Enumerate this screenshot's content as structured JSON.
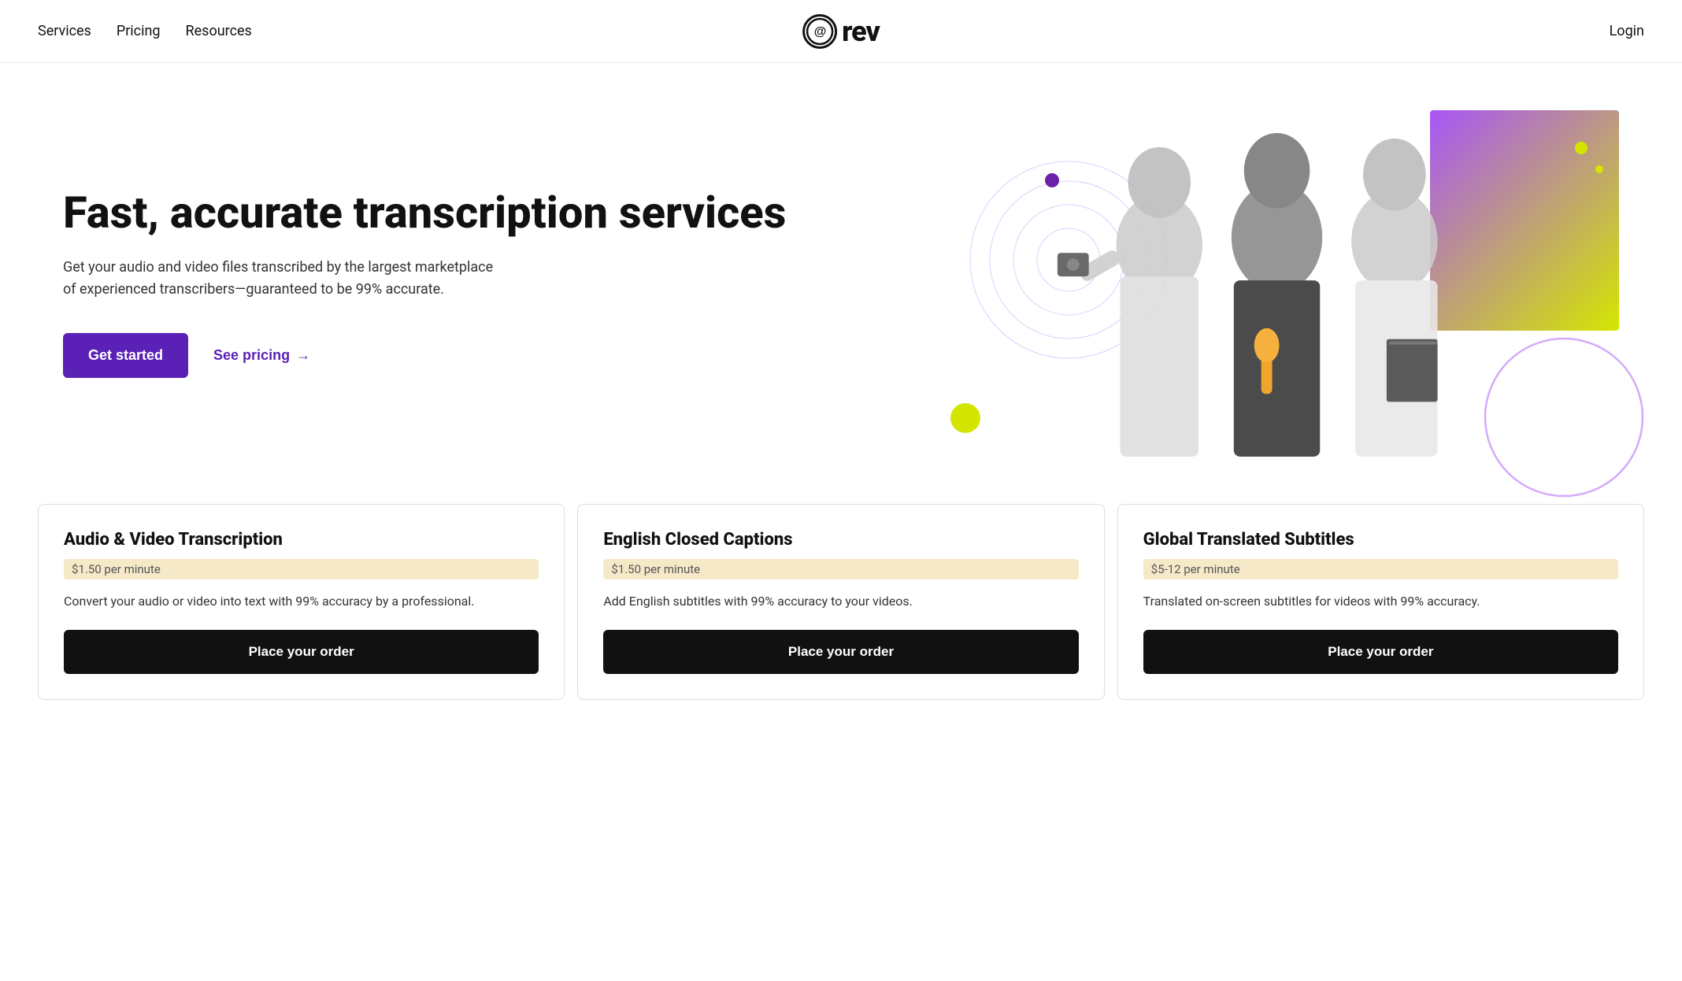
{
  "header": {
    "nav_left": [
      {
        "label": "Services",
        "id": "services"
      },
      {
        "label": "Pricing",
        "id": "pricing"
      },
      {
        "label": "Resources",
        "id": "resources"
      }
    ],
    "logo_text": "rev",
    "logo_at": "@",
    "login_label": "Login"
  },
  "hero": {
    "title": "Fast, accurate transcription services",
    "subtitle": "Get your audio and video files transcribed by the largest marketplace of experienced transcribers—guaranteed to be 99% accurate.",
    "cta_primary": "Get started",
    "cta_secondary": "See pricing",
    "cta_arrow": "→"
  },
  "services": [
    {
      "title": "Audio & Video Transcription",
      "price": "$1.50 per minute",
      "description": "Convert your audio or video into text with 99% accuracy by a professional.",
      "cta": "Place your order"
    },
    {
      "title": "English Closed Captions",
      "price": "$1.50 per minute",
      "description": "Add English subtitles with 99% accuracy to your videos.",
      "cta": "Place your order"
    },
    {
      "title": "Global Translated Subtitles",
      "price": "$5-12 per minute",
      "description": "Translated on-screen subtitles for videos with 99% accuracy.",
      "cta": "Place your order"
    }
  ]
}
